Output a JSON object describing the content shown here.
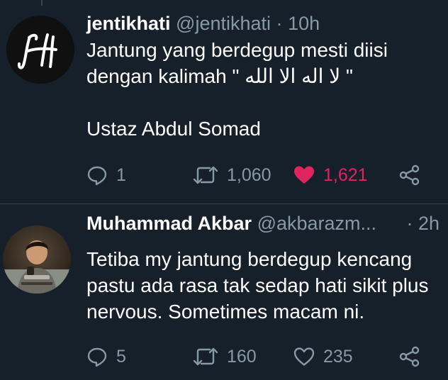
{
  "tweets": [
    {
      "display_name": "jentikhati",
      "handle": "@jentikhati",
      "separator": "·",
      "time": "10h",
      "text": "Jantung yang berdegup mesti diisi\ndengan kalimah \" لا اله الا الله \"\n\nUstaz Abdul Somad",
      "avatar_icon": "jh-monogram-logo",
      "replies": "1",
      "retweets": "1,060",
      "likes": "1,621",
      "liked": true
    },
    {
      "display_name": "Muhammad Akbar",
      "handle": "@akbarazm...",
      "separator": "·",
      "time": "2h",
      "text": "Tetiba my jantung berdegup kencang pastu ada rasa tak sedap hati sikit plus nervous. Sometimes macam ni.",
      "avatar_icon": "user-photo",
      "replies": "5",
      "retweets": "160",
      "likes": "235",
      "liked": false
    }
  ],
  "colors": {
    "background": "#15202b",
    "text_primary": "#ffffff",
    "text_secondary": "#8899a6",
    "like_active": "#e0245e",
    "divider": "#38444d"
  }
}
